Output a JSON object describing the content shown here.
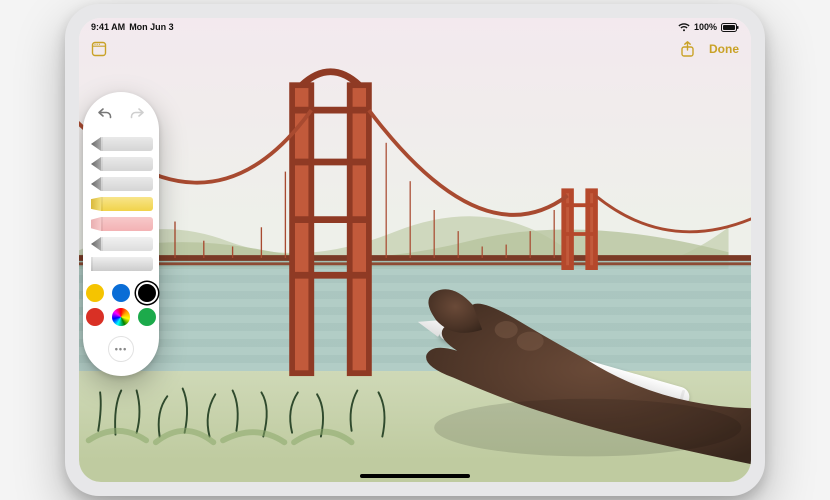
{
  "status": {
    "time": "9:41 AM",
    "date": "Mon Jun 3",
    "battery_text": "100%",
    "wifi_icon": "wifi",
    "battery_icon": "battery-full"
  },
  "app_bar": {
    "notes_icon": "notes",
    "share_icon": "share",
    "done_label": "Done"
  },
  "palette": {
    "undo_icon": "undo",
    "redo_icon": "redo",
    "tools": [
      {
        "name": "pen",
        "label": "Pen"
      },
      {
        "name": "marker",
        "label": "Marker"
      },
      {
        "name": "pencil",
        "label": "Pencil"
      },
      {
        "name": "highlighter",
        "label": "Highlighter"
      },
      {
        "name": "eraser",
        "label": "Eraser"
      },
      {
        "name": "lasso",
        "label": "Lasso"
      },
      {
        "name": "ruler",
        "label": "Ruler"
      }
    ],
    "swatches": [
      {
        "name": "black",
        "hex": "#000000",
        "selected": true
      },
      {
        "name": "blue",
        "hex": "#0a6dd6"
      },
      {
        "name": "yellow",
        "hex": "#f5c400"
      },
      {
        "name": "red",
        "hex": "#d93025"
      },
      {
        "name": "green",
        "hex": "#1caa4b"
      },
      {
        "name": "rainbow",
        "hex": "rainbow"
      }
    ],
    "more_label": "•••"
  },
  "colors": {
    "accent": "#c9a227",
    "bridge": "#b5482b",
    "water": "#9fbfb8",
    "foliage_dark": "#2f4a2d",
    "foliage_light": "#8aa86a"
  }
}
